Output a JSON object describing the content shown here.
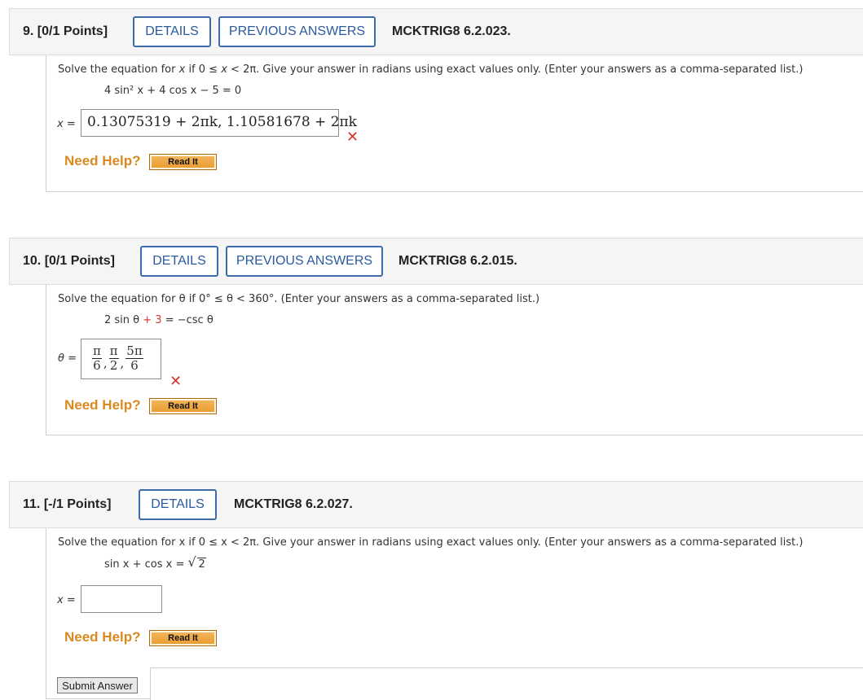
{
  "questions": [
    {
      "number": "9.",
      "points": "[0/1 Points]",
      "details_label": "DETAILS",
      "previous_label": "PREVIOUS ANSWERS",
      "code": "MCKTRIG8 6.2.023.",
      "prompt_pre": "Solve the equation for ",
      "prompt_var": "x",
      "prompt_mid": " if 0 ≤ ",
      "prompt_var2": "x",
      "prompt_post": " < 2π. Give your answer in radians using exact values only. (Enter your answers as a comma-separated list.)",
      "equation": "4 sin² x + 4 cos x − 5 = 0",
      "answer_label": "x =",
      "answer_value": "0.13075319 + 2πk, 1.10581678 + 2πk",
      "result": "incorrect",
      "need_help": "Need Help?",
      "read_it": "Read It"
    },
    {
      "number": "10.",
      "points": "[0/1 Points]",
      "details_label": "DETAILS",
      "previous_label": "PREVIOUS ANSWERS",
      "code": "MCKTRIG8 6.2.015.",
      "prompt": "Solve the equation for θ if 0° ≤ θ < 360°. (Enter your answers as a comma-separated list.)",
      "equation_a": "2 sin θ",
      "equation_b": "+ 3",
      "equation_c": "= −csc θ",
      "answer_label": "θ =",
      "answer_fracs": [
        {
          "num": "π",
          "den": "6"
        },
        {
          "num": "π",
          "den": "2"
        },
        {
          "num": "5π",
          "den": "6"
        }
      ],
      "result": "incorrect",
      "need_help": "Need Help?",
      "read_it": "Read It"
    },
    {
      "number": "11.",
      "points": "[-/1 Points]",
      "details_label": "DETAILS",
      "code": "MCKTRIG8 6.2.027.",
      "prompt": "Solve the equation for x if 0 ≤ x < 2π. Give your answer in radians using exact values only. (Enter your answers as a comma-separated list.)",
      "equation_pre": "sin x + cos x = ",
      "equation_radical": "√",
      "equation_radicand": "2",
      "answer_label": "x =",
      "answer_value": "",
      "need_help": "Need Help?",
      "read_it": "Read It"
    }
  ],
  "submit_label": "Submit Answer",
  "colors": {
    "button_border": "#3d6aa8",
    "help_orange": "#d98a1f",
    "error_red": "#d9342b"
  }
}
